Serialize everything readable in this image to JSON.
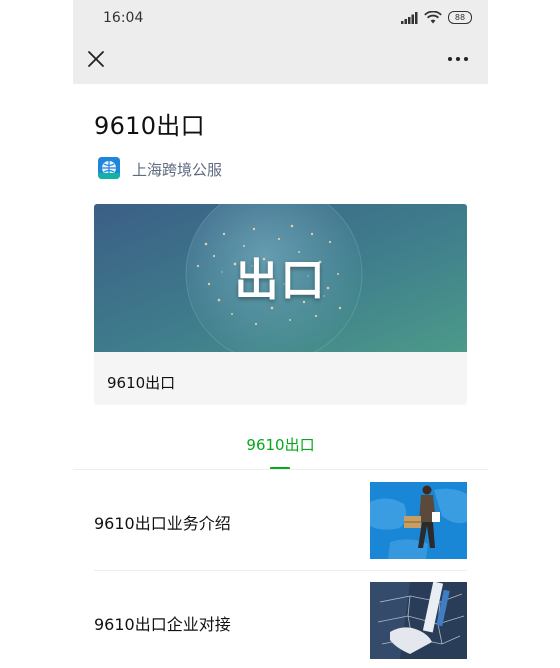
{
  "status_bar": {
    "time": "16:04",
    "battery": "88"
  },
  "article": {
    "title": "9610出口"
  },
  "account": {
    "name": "上海跨境公服"
  },
  "banner": {
    "image_text": "出口",
    "caption": "9610出口"
  },
  "tab": {
    "label": "9610出口",
    "active_color": "#07a81b"
  },
  "list": [
    {
      "title": "9610出口业务介绍",
      "thumbnail": "courier-with-package-image"
    },
    {
      "title": "9610出口企业对接",
      "thumbnail": "business-handshake-image"
    }
  ]
}
